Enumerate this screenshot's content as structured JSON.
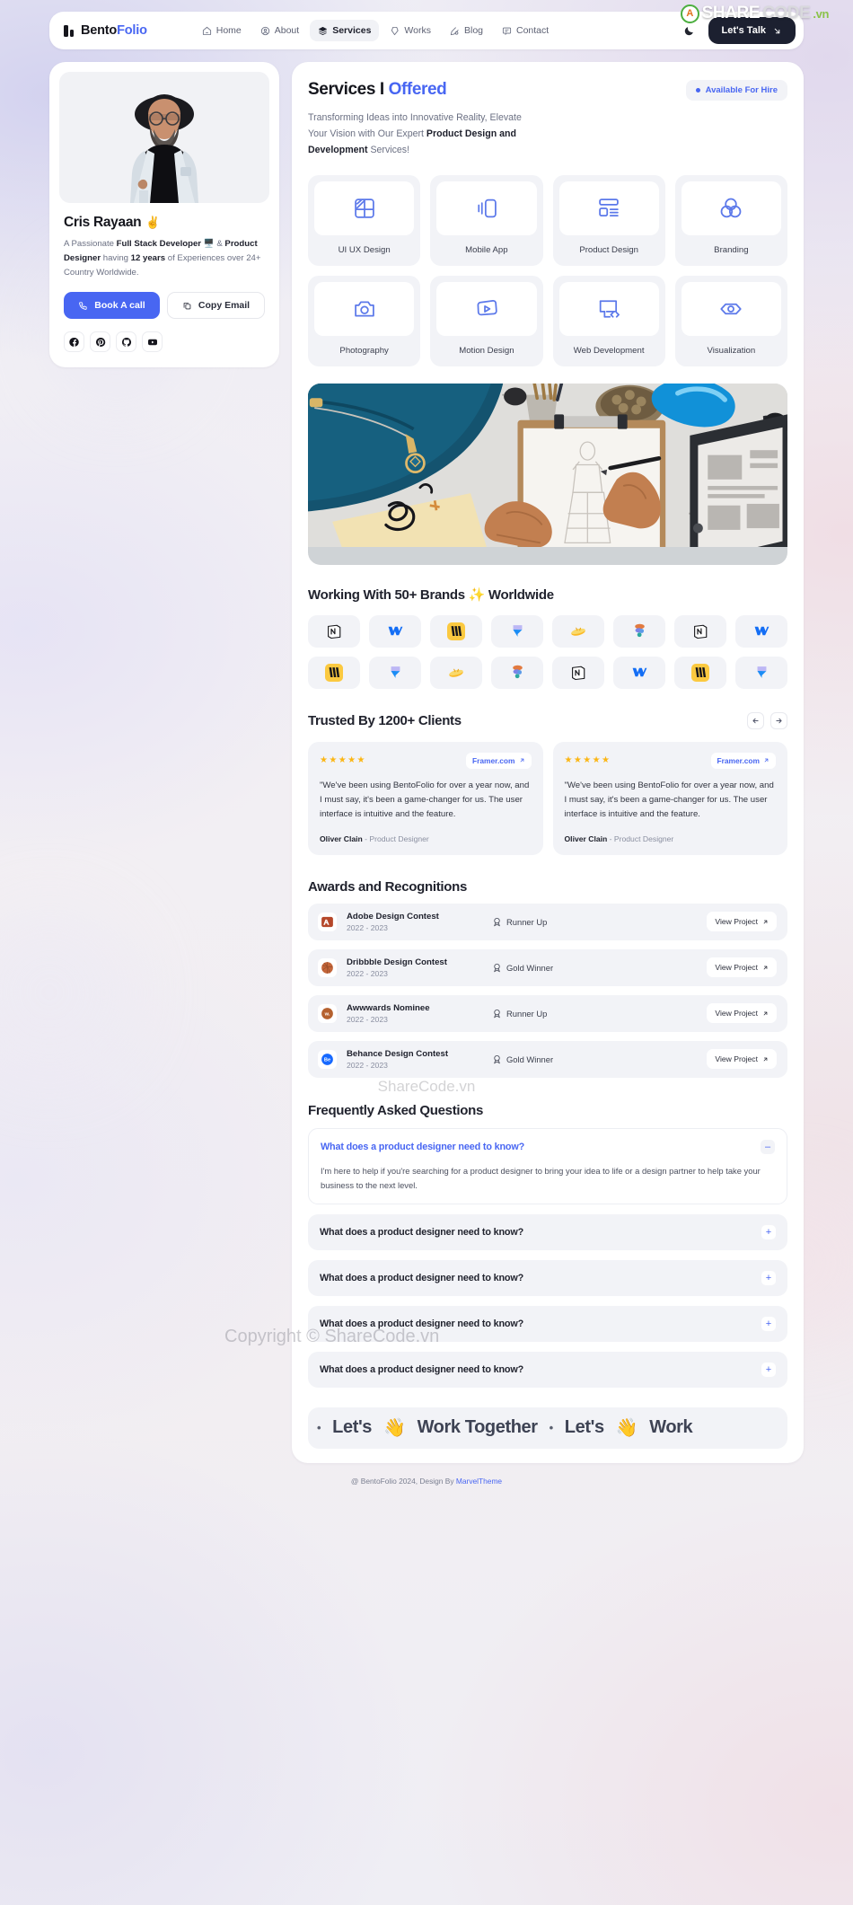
{
  "watermarks": {
    "top_badge": "A",
    "top_share": "SHARE",
    "top_code": "CODE",
    "top_vn": ".vn",
    "center": "ShareCode.vn",
    "copyright": "Copyright © ShareCode.vn"
  },
  "header": {
    "brand_first": "Bento",
    "brand_second": "Folio",
    "nav": [
      {
        "label": "Home",
        "icon": "home-icon",
        "active": false
      },
      {
        "label": "About",
        "icon": "user-icon",
        "active": false
      },
      {
        "label": "Services",
        "icon": "layers-icon",
        "active": true
      },
      {
        "label": "Works",
        "icon": "diamond-icon",
        "active": false
      },
      {
        "label": "Blog",
        "icon": "pen-icon",
        "active": false
      },
      {
        "label": "Contact",
        "icon": "message-icon",
        "active": false
      }
    ],
    "theme_toggle_icon": "moon-icon",
    "cta_label": "Let's Talk",
    "cta_icon": "arrow-down-right-icon"
  },
  "profile": {
    "avatar_alt": "profile-photo",
    "name": "Cris Rayaan",
    "name_emoji": "✌️",
    "bio_1": "A Passionate ",
    "bio_b1": "Full Stack Developer",
    "bio_emoji": "🖥️",
    "bio_amp": "&",
    "bio_b2": "Product Designer",
    "bio_2": " having ",
    "bio_b3": "12 years",
    "bio_3": " of Experiences over 24+ Country Worldwide.",
    "btn_call": "Book A call",
    "btn_copy": "Copy Email",
    "socials": [
      "facebook-icon",
      "pinterest-icon",
      "github-icon",
      "youtube-icon"
    ]
  },
  "services_section": {
    "title_plain": "Services I ",
    "title_accent": "Offered",
    "badge": "Available For Hire",
    "sub_1": "Transforming Ideas into Innovative Reality, Elevate Your Vision with Our Expert ",
    "sub_b1": "Product Design and Development",
    "sub_2": " Services!",
    "cards": [
      {
        "label": "UI UX Design",
        "icon": "ui-ux-icon"
      },
      {
        "label": "Mobile App",
        "icon": "mobile-icon"
      },
      {
        "label": "Product Design",
        "icon": "layout-icon"
      },
      {
        "label": "Branding",
        "icon": "venn-icon"
      },
      {
        "label": "Photography",
        "icon": "camera-icon"
      },
      {
        "label": "Motion Design",
        "icon": "play-icon"
      },
      {
        "label": "Web Development",
        "icon": "monitor-code-icon"
      },
      {
        "label": "Visualization",
        "icon": "eye-icon"
      }
    ]
  },
  "hero": {
    "alt": "fashion-sketching-desk-photo"
  },
  "brands": {
    "title_1": "Working With 50+ Brands ",
    "title_emoji": "✨",
    "title_2": " Worldwide",
    "logos": [
      "notion-icon",
      "webflow-icon",
      "mailchimp-icon",
      "framer-icon",
      "zeplin-icon",
      "figma-icon",
      "notion-icon",
      "webflow-icon",
      "mailchimp-icon",
      "framer-icon",
      "zeplin-icon",
      "figma-icon",
      "notion-icon",
      "webflow-icon",
      "mailchimp-icon",
      "framer-icon"
    ]
  },
  "testimonials": {
    "title": "Trusted By 1200+ Clients",
    "prev_icon": "arrow-left-icon",
    "next_icon": "arrow-right-icon",
    "items": [
      {
        "stars": "★★★★★",
        "source": "Framer.com",
        "quote": "\"We've been using BentoFolio for over a year now, and I must say, it's been a game-changer for us. The user interface is intuitive and the feature.",
        "author": "Oliver Clain",
        "role": " - Product Designer"
      },
      {
        "stars": "★★★★★",
        "source": "Framer.com",
        "quote": "\"We've been using BentoFolio for over a year now, and I must say, it's been a game-changer for us. The user interface is intuitive and the feature.",
        "author": "Oliver Clain",
        "role": " - Product Designer"
      }
    ]
  },
  "awards": {
    "title": "Awards and Recognitions",
    "button_label": "View Project",
    "rows": [
      {
        "logo": "adobe-icon",
        "name": "Adobe Design Contest",
        "year": "2022 - 2023",
        "rank": "Runner Up",
        "rank_icon": "medal-icon"
      },
      {
        "logo": "dribbble-icon",
        "name": "Dribbble Design Contest",
        "year": "2022 - 2023",
        "rank": "Gold Winner",
        "rank_icon": "medal-icon"
      },
      {
        "logo": "awwwards-icon",
        "name": "Awwwards Nominee",
        "year": "2022 - 2023",
        "rank": "Runner Up",
        "rank_icon": "medal-icon"
      },
      {
        "logo": "behance-icon",
        "name": "Behance Design Contest",
        "year": "2022 - 2023",
        "rank": "Gold Winner",
        "rank_icon": "medal-icon"
      }
    ]
  },
  "faq": {
    "title": "Frequently Asked Questions",
    "items": [
      {
        "question": "What does a product designer need to know?",
        "answer": "I'm here to help if you're searching for a product designer to bring your idea to life or a design partner to help take your business to the next level.",
        "open": true,
        "sign": "–"
      },
      {
        "question": "What does a product designer need to know?",
        "answer": "",
        "open": false,
        "sign": "+"
      },
      {
        "question": "What does a product designer need to know?",
        "answer": "",
        "open": false,
        "sign": "+"
      },
      {
        "question": "What does a product designer need to know?",
        "answer": "",
        "open": false,
        "sign": "+"
      },
      {
        "question": "What does a product designer need to know?",
        "answer": "",
        "open": false,
        "sign": "+"
      }
    ]
  },
  "marquee": {
    "dot": "•",
    "text_a": "Let's",
    "emoji": "👋",
    "text_b": "Work Together",
    "text_c": "Let's",
    "text_d": "Work"
  },
  "footer": {
    "text": "@ BentoFolio 2024, Design By ",
    "link": "MarvelTheme"
  },
  "colors": {
    "accent": "#4866f2",
    "dark": "#1c2030",
    "panel": "#f2f3f7",
    "star": "#fbb614"
  }
}
